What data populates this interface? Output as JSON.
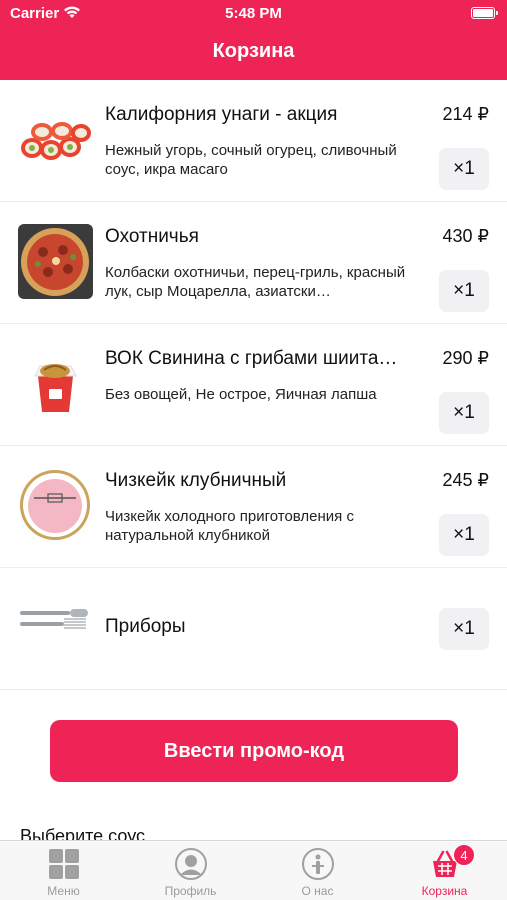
{
  "status_bar": {
    "carrier": "Carrier",
    "time": "5:48 PM"
  },
  "header": {
    "title": "Корзина"
  },
  "cart": {
    "items": [
      {
        "name": "Калифорния унаги - акция",
        "description": "Нежный угорь, сочный огурец, сливочный соус, икра масаго",
        "price": "214 ₽",
        "quantity": "×1",
        "image_icon": "sushi-roll-image"
      },
      {
        "name": "Охотничья",
        "description": "Колбаски охотничьи, перец-гриль, красный лук, сыр Моцарелла, азиатски…",
        "price": "430 ₽",
        "quantity": "×1",
        "image_icon": "pizza-image"
      },
      {
        "name": "ВОК Свинина с грибами шиитаке…",
        "description": "Без овощей, Не острое, Яичная лапша",
        "price": "290 ₽",
        "quantity": "×1",
        "image_icon": "wok-box-image"
      },
      {
        "name": "Чизкейк клубничный",
        "description": "Чизкейк холодного приготовления с натуральной клубникой",
        "price": "245 ₽",
        "quantity": "×1",
        "image_icon": "cheesecake-image"
      }
    ],
    "cutlery": {
      "name": "Приборы",
      "quantity": "×1",
      "image_icon": "cutlery-image"
    }
  },
  "promo_button": {
    "label": "Ввести промо-код"
  },
  "sauce_section": {
    "title": "Выберите соус"
  },
  "tabbar": {
    "tabs": [
      {
        "label": "Меню",
        "icon": "menu-grid-icon"
      },
      {
        "label": "Профиль",
        "icon": "profile-icon"
      },
      {
        "label": "О нас",
        "icon": "about-icon"
      },
      {
        "label": "Корзина",
        "icon": "basket-icon",
        "badge": "4"
      }
    ]
  },
  "colors": {
    "accent": "#EE2457",
    "tab_inactive": "#9a9a9a",
    "qty_bg": "#F1F1F3"
  }
}
